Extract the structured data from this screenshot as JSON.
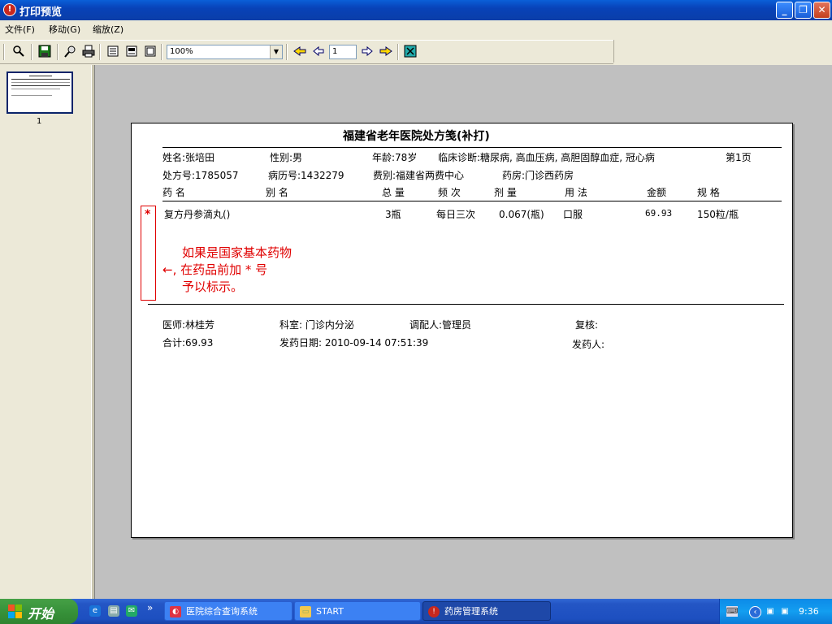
{
  "window": {
    "title": "打印预览",
    "minimize": "_",
    "restore": "❐",
    "close": "✕"
  },
  "menu": [
    {
      "label": "文件(F)"
    },
    {
      "label": "移动(G)"
    },
    {
      "label": "缩放(Z)"
    }
  ],
  "toolbar": {
    "zoom_value": "100%",
    "page_value": "1",
    "icons": [
      "search-icon",
      "save-icon",
      "find-icon",
      "print-icon",
      "single-page-icon",
      "two-page-icon",
      "multi-page-icon",
      "first-page-icon",
      "prev-page-icon",
      "next-page-icon",
      "last-page-icon",
      "close-preview-icon"
    ]
  },
  "thumbnail": {
    "page_number": "1"
  },
  "prescription": {
    "title": "福建省老年医院处方笺(补打)",
    "patient": {
      "name": "姓名:张培田",
      "gender": "性别:男",
      "age": "年龄:78岁",
      "diagnosis": "临床诊断:糖尿病, 高血压病, 高胆固醇血症, 冠心病",
      "page": "第1页",
      "rx_no": "处方号:1785057",
      "record_no": "病历号:1432279",
      "fee_type": "费别:福建省两费中心",
      "pharmacy": "药房:门诊西药房"
    },
    "columns": [
      "药  名",
      "别  名",
      "总  量",
      "频  次",
      "剂  量",
      "用  法",
      "金额",
      "规  格"
    ],
    "items": [
      {
        "name": "复方丹参滴丸()",
        "alias": "",
        "total": "3瓶",
        "frequency": "每日三次",
        "dose": "0.067(瓶)",
        "usage": "口服",
        "amount": "69.93",
        "spec": "150粒/瓶"
      }
    ],
    "annotation": {
      "marker": "*",
      "line1": "如果是国家基本药物",
      "line2": "←, 在药品前加 * 号",
      "line3": "予以标示。"
    },
    "footer": {
      "doctor": "医师:林桂芳",
      "department": "科室: 门诊内分泌",
      "dispenser": "调配人:管理员",
      "reviewer": "复核:",
      "total": "合计:69.93",
      "dispense_date": "发药日期: 2010-09-14   07:51:39",
      "issuer": "发药人:"
    }
  },
  "taskbar": {
    "start_label": "开始",
    "overflow": "»",
    "tasks": [
      {
        "label": "医院综合查询系统"
      },
      {
        "label": "START"
      },
      {
        "label": "药房管理系统"
      }
    ],
    "clock": "9:36"
  }
}
